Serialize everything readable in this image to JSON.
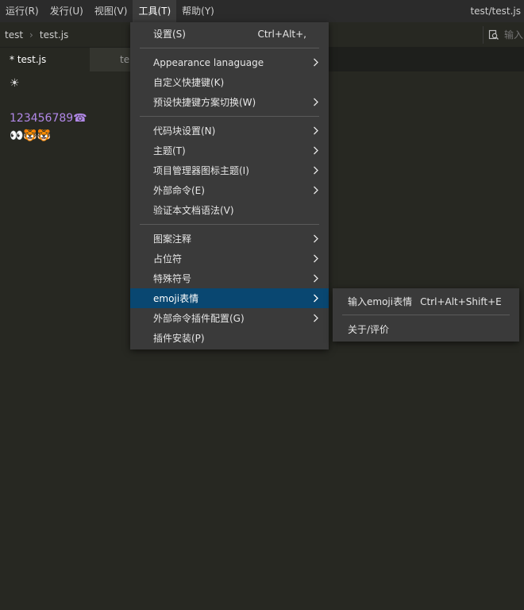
{
  "menubar": {
    "items": [
      "运行(R)",
      "发行(U)",
      "视图(V)",
      "工具(T)",
      "帮助(Y)"
    ],
    "window_title": "test/test.js"
  },
  "breadcrumb": {
    "folder": "test",
    "file": "test.js"
  },
  "search": {
    "placeholder": "输入"
  },
  "tabs": [
    {
      "label": "* test.js"
    },
    {
      "label": "te"
    }
  ],
  "editor": {
    "lines": [
      "☀",
      "",
      "123456789☎",
      "👀🐯🐯"
    ]
  },
  "tools_menu": {
    "items": [
      {
        "label": "设置(S)",
        "shortcut": "Ctrl+Alt+,"
      },
      {
        "label": "Appearance lanaguage"
      },
      {
        "label": "自定义快捷键(K)"
      },
      {
        "label": "预设快捷键方案切换(W)"
      },
      {
        "label": "代码块设置(N)"
      },
      {
        "label": "主题(T)"
      },
      {
        "label": "项目管理器图标主题(I)"
      },
      {
        "label": "外部命令(E)"
      },
      {
        "label": "验证本文档语法(V)"
      },
      {
        "label": "图案注释"
      },
      {
        "label": "占位符"
      },
      {
        "label": "特殊符号"
      },
      {
        "label": "emoji表情"
      },
      {
        "label": "外部命令插件配置(G)"
      },
      {
        "label": "插件安装(P)"
      }
    ]
  },
  "emoji_submenu": {
    "items": [
      {
        "label": "输入emoji表情",
        "shortcut": "Ctrl+Alt+Shift+E"
      },
      {
        "label": "关于/评价"
      }
    ]
  },
  "colors": {
    "highlight": "#094771",
    "editor_bg": "#272822",
    "menu_bg": "#3a3a3a",
    "number_text": "#b188e8"
  }
}
